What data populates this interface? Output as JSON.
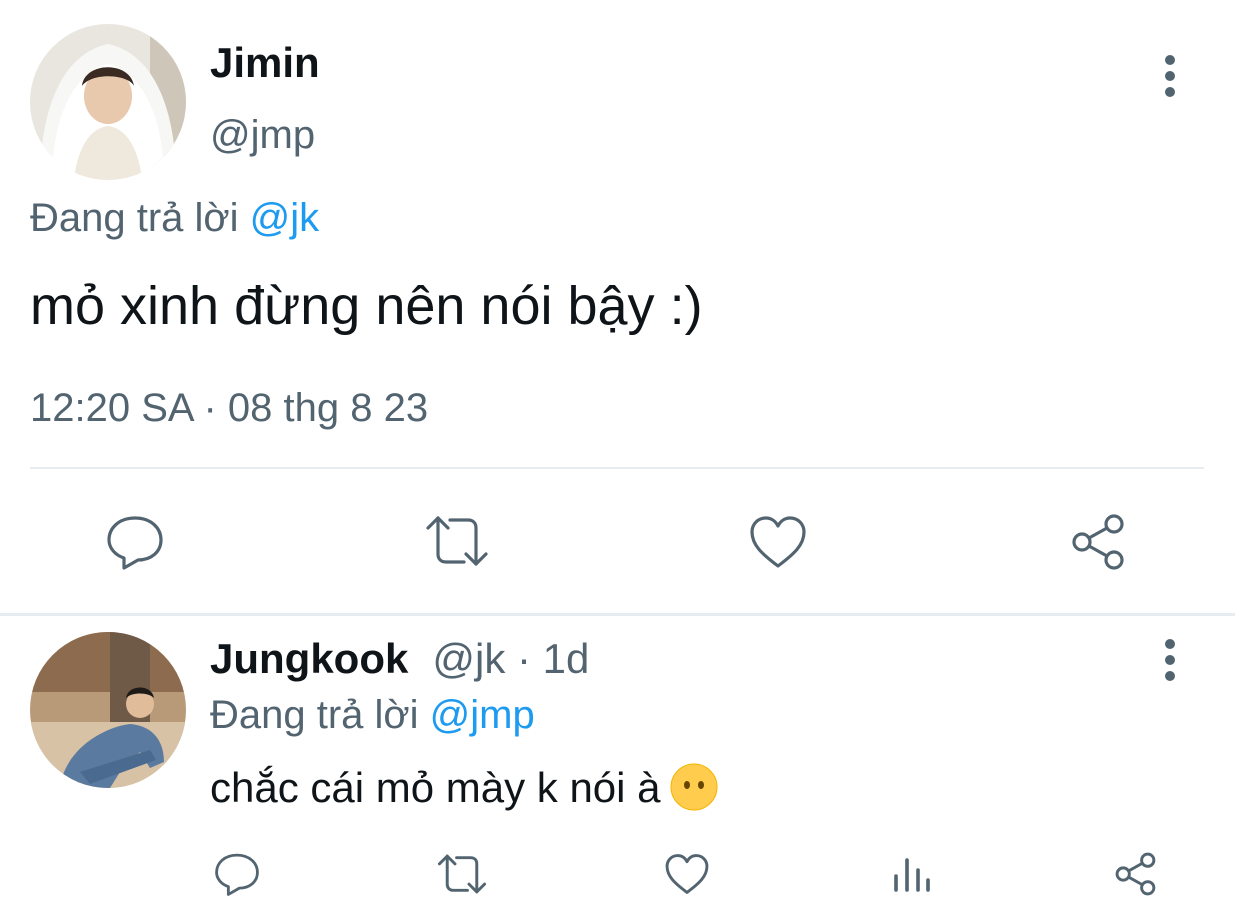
{
  "main_tweet": {
    "name": "Jimin",
    "handle": "@jmp",
    "replying_prefix": "Đang trả lời",
    "replying_to": "@jk",
    "text": "mỏ xinh đừng nên nói bậy :)",
    "timestamp": "12:20 SA · 08 thg 8 23",
    "actions": [
      "reply-icon",
      "retweet-icon",
      "like-icon",
      "share-icon"
    ]
  },
  "reply_tweet": {
    "name": "Jungkook",
    "handle_time": "@jk · 1d",
    "replying_prefix": "Đang trả lời",
    "replying_to": "@jmp",
    "text": "chắc cái mỏ mày k nói à",
    "emoji": "face-without-mouth",
    "actions": [
      "reply-icon",
      "retweet-icon",
      "like-icon",
      "analytics-icon",
      "share-icon"
    ]
  },
  "colors": {
    "text": "#0f1419",
    "muted": "#536471",
    "link": "#1d9bf0",
    "divider": "#e6ecf0"
  }
}
